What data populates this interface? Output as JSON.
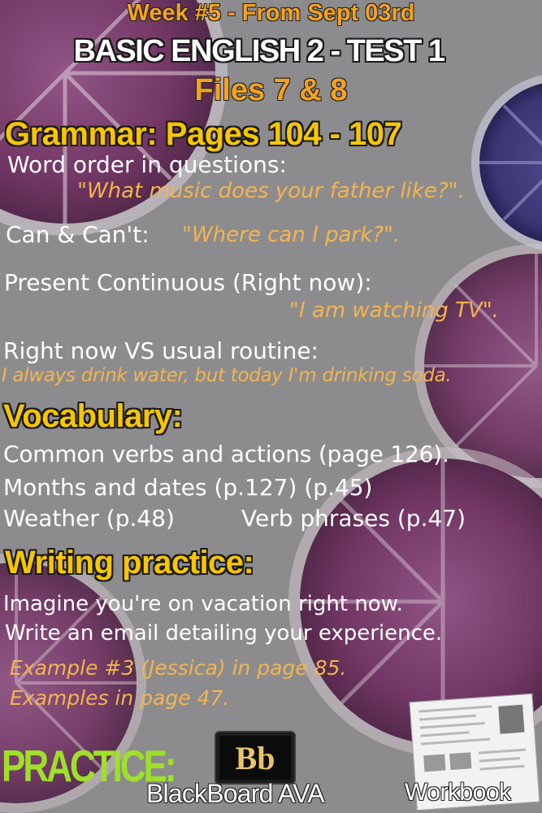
{
  "header": {
    "week": "Week #5 - From Sept 03rd",
    "title": "BASIC ENGLISH 2  -  TEST 1",
    "files": "Files 7 & 8"
  },
  "grammar": {
    "heading": "Grammar: Pages 104 - 107",
    "items": [
      {
        "label": "Word order in questions:",
        "example": "\"What music does your father like?\"."
      },
      {
        "label": "Can & Can't:",
        "example": "\"Where can I park?\"."
      },
      {
        "label": "Present Continuous (Right now):",
        "example": "\"I am watching TV\"."
      },
      {
        "label": "Right now VS usual routine:",
        "example": "I always drink water, but today I'm drinking soda."
      }
    ]
  },
  "vocabulary": {
    "heading": "Vocabulary:",
    "lines": [
      "Common verbs and actions (page 126).",
      "Months and dates (p.127) (p.45)",
      "Weather (p.48)",
      "Verb phrases (p.47)"
    ]
  },
  "writing": {
    "heading": "Writing practice:",
    "lines": [
      "Imagine you're on vacation right now.",
      "Write an email detailing your experience."
    ],
    "examples": [
      "Example #3 (Jessica) in page 85.",
      "Examples in page 47."
    ]
  },
  "practice": {
    "label": "PRACTICE:",
    "blackboard_logo": "Bb",
    "blackboard_label": "BlackBoard AVA",
    "workbook_label": "Workbook"
  },
  "colors": {
    "background": "#8c8c8e",
    "heading_yellow": "#f7c600",
    "header_orange": "#f6a21e",
    "example_orange": "#f3b44f",
    "practice_green": "#9ee02a",
    "fruit_purple": "#6b2a5c"
  }
}
